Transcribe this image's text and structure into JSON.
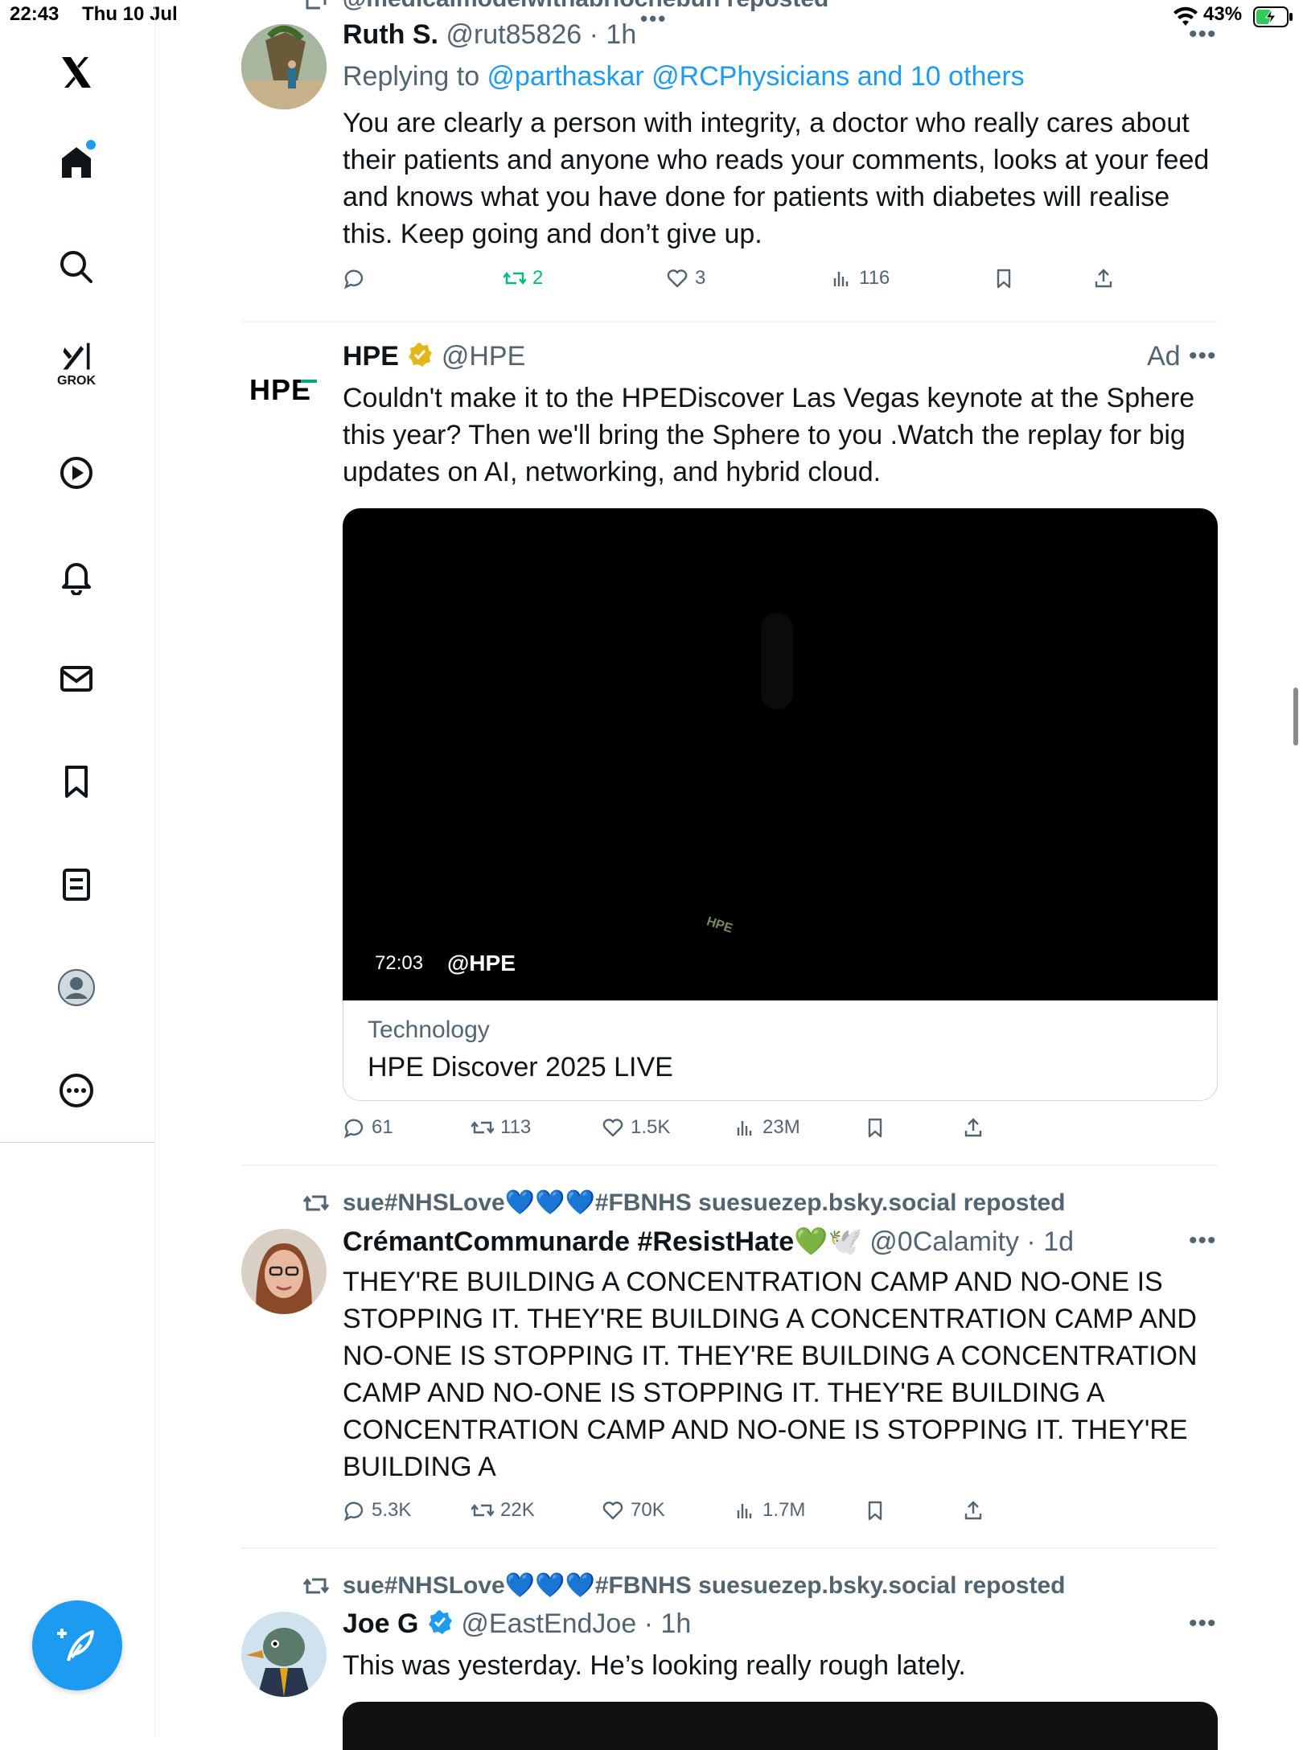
{
  "status_bar": {
    "time": "22:43",
    "date": "Thu 10 Jul",
    "battery": "43%"
  },
  "sidebar": {
    "items": [
      {
        "name": "x-logo-icon"
      },
      {
        "name": "home-icon",
        "badge": true
      },
      {
        "name": "search-icon"
      },
      {
        "name": "grok-icon",
        "label": "GROK"
      },
      {
        "name": "video-icon"
      },
      {
        "name": "notifications-icon"
      },
      {
        "name": "messages-icon"
      },
      {
        "name": "bookmarks-icon"
      },
      {
        "name": "lists-icon"
      },
      {
        "name": "profile-icon"
      },
      {
        "name": "more-icon"
      }
    ]
  },
  "top_repost": {
    "text": "@medicalmodelwithabriochebun reposted"
  },
  "tweet1": {
    "name": "Ruth S.",
    "handle": "@rut85826",
    "time": "1h",
    "replying_prefix": "Replying to ",
    "replying_to": "@parthaskar @RCPhysicians and 10 others",
    "text": "You are clearly a person with integrity, a doctor who really cares about their patients and anyone who reads your comments, looks at your feed and knows what you have done for patients with diabetes will realise this. Keep going and don’t give up.",
    "actions": {
      "reply": "",
      "retweet": "2",
      "like": "3",
      "views": "116"
    }
  },
  "tweet2": {
    "name": "HPE",
    "handle": "@HPE",
    "ad_label": "Ad",
    "logo_text": "HPE",
    "text": "Couldn't make it to the HPEDiscover Las Vegas keynote at the Sphere this year? Then we'll bring the Sphere to you .Watch the replay for big updates on AI, networking, and hybrid cloud.",
    "video": {
      "duration": "72:03",
      "channel": "@HPE",
      "watermark": "HPE"
    },
    "card": {
      "category": "Technology",
      "title": "HPE Discover 2025 LIVE"
    },
    "actions": {
      "reply": "61",
      "retweet": "113",
      "like": "1.5K",
      "views": "23M"
    }
  },
  "tweet3": {
    "reposted_by": "sue#NHSLove💙💙💙#FBNHS suesuezep.bsky.social reposted",
    "name": "CrémantCommunarde #ResistHate💚🕊️",
    "handle": "@0Calamity",
    "time": "1d",
    "text": "THEY'RE BUILDING A CONCENTRATION CAMP AND NO-ONE IS STOPPING IT. THEY'RE BUILDING A CONCENTRATION CAMP AND NO-ONE IS STOPPING IT. THEY'RE BUILDING A CONCENTRATION CAMP AND NO-ONE IS STOPPING IT. THEY'RE BUILDING A CONCENTRATION CAMP AND NO-ONE IS STOPPING IT. THEY'RE BUILDING A",
    "actions": {
      "reply": "5.3K",
      "retweet": "22K",
      "like": "70K",
      "views": "1.7M"
    }
  },
  "tweet4": {
    "reposted_by": "sue#NHSLove💙💙💙#FBNHS suesuezep.bsky.social reposted",
    "name": "Joe G",
    "handle": "@EastEndJoe",
    "time": "1h",
    "text": "This was yesterday. He’s looking really rough lately."
  },
  "colors": {
    "accent": "#1d9bf0",
    "retweet_active": "#00ba7c",
    "secondary_text": "#536471",
    "verified_gold": "#e2b719",
    "hpe_green": "#01a982"
  }
}
